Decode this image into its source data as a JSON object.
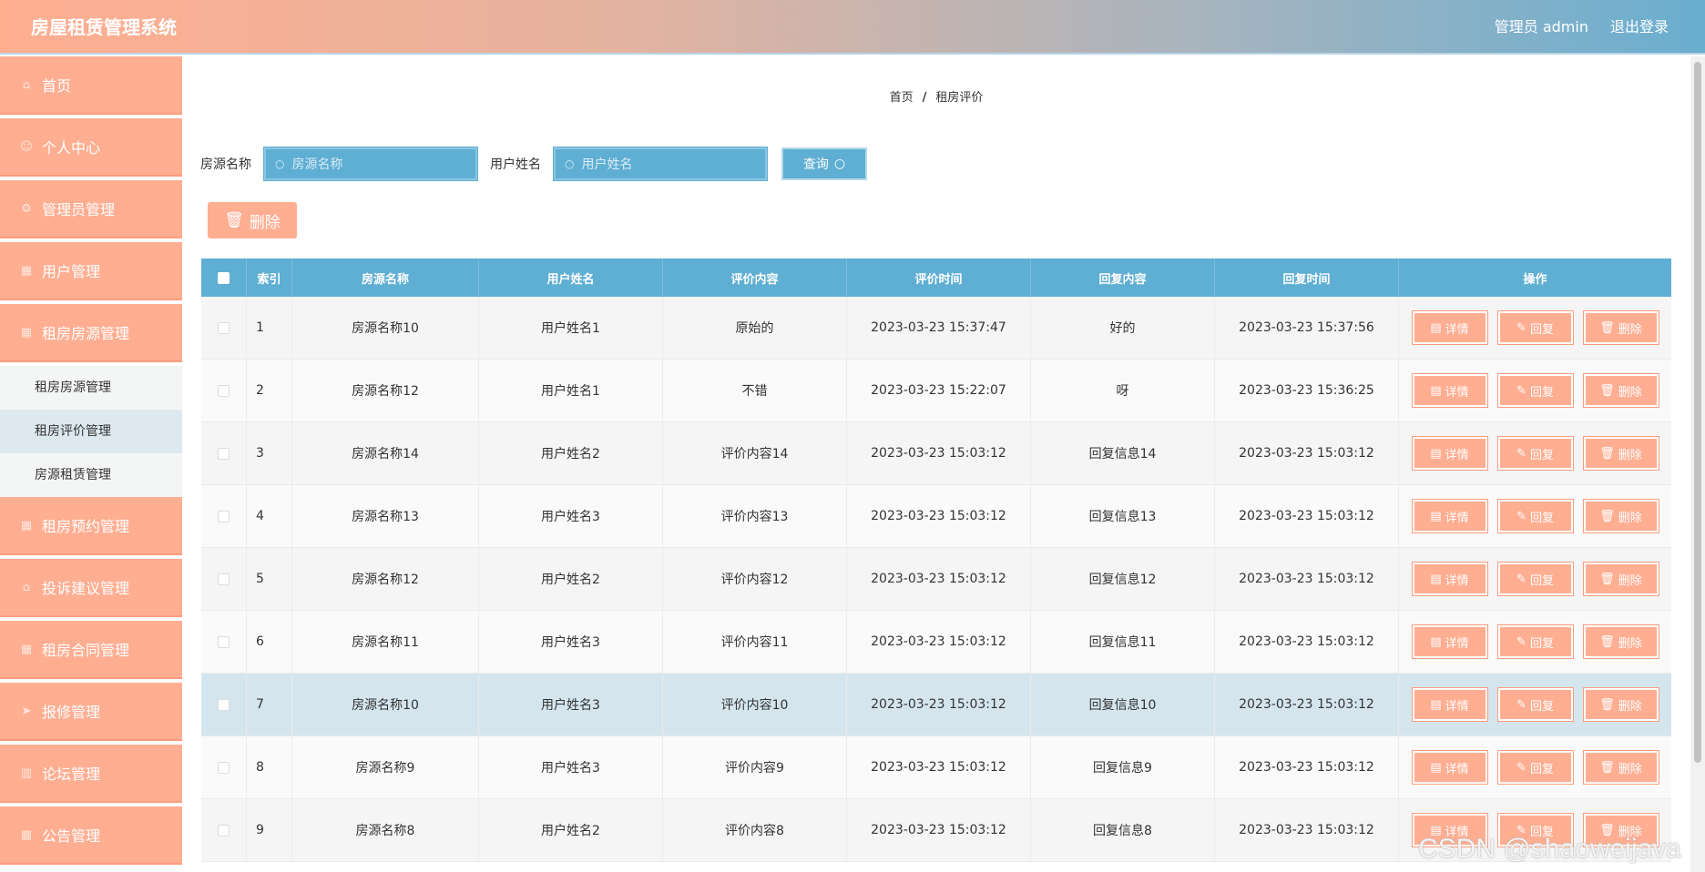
{
  "app": {
    "title": "房屋租赁管理系统"
  },
  "header": {
    "user": "管理员 admin",
    "logout": "退出登录"
  },
  "sidebar": {
    "items": [
      {
        "label": "首页",
        "icon": "home-icon",
        "glyph": "⌂"
      },
      {
        "label": "个人中心",
        "icon": "user-icon",
        "glyph": "☺"
      },
      {
        "label": "管理员管理",
        "icon": "settings-icon",
        "glyph": "⚙"
      },
      {
        "label": "用户管理",
        "icon": "grid-icon",
        "glyph": "▦"
      },
      {
        "label": "租房房源管理",
        "icon": "grid-icon",
        "glyph": "▦"
      }
    ],
    "submenu": [
      {
        "label": "租房房源管理"
      },
      {
        "label": "租房评价管理"
      },
      {
        "label": "房源租赁管理"
      }
    ],
    "items_after": [
      {
        "label": "租房预约管理",
        "icon": "grid-icon",
        "glyph": "▦"
      },
      {
        "label": "投诉建议管理",
        "icon": "home-icon",
        "glyph": "⌂"
      },
      {
        "label": "租房合同管理",
        "icon": "grid-icon",
        "glyph": "▦"
      },
      {
        "label": "报修管理",
        "icon": "send-icon",
        "glyph": "➤"
      },
      {
        "label": "论坛管理",
        "icon": "chart-icon",
        "glyph": "▥"
      },
      {
        "label": "公告管理",
        "icon": "grid-icon",
        "glyph": "▦"
      }
    ]
  },
  "breadcrumb": {
    "home": "首页",
    "separator": "/",
    "current": "租房评价"
  },
  "search": {
    "house_label": "房源名称",
    "house_placeholder": "房源名称",
    "user_label": "用户姓名",
    "user_placeholder": "用户姓名",
    "query_label": "查询"
  },
  "actions": {
    "delete_label": "删除"
  },
  "table": {
    "headers": [
      "索引",
      "房源名称",
      "用户姓名",
      "评价内容",
      "评价时间",
      "回复内容",
      "回复时间",
      "操作"
    ],
    "row_actions": {
      "detail": "详情",
      "reply": "回复",
      "delete": "删除"
    },
    "rows": [
      {
        "index": "1",
        "house": "房源名称10",
        "user": "用户姓名1",
        "content": "原始的",
        "time": "2023-03-23 15:37:47",
        "reply": "好的",
        "reply_time": "2023-03-23 15:37:56"
      },
      {
        "index": "2",
        "house": "房源名称12",
        "user": "用户姓名1",
        "content": "不错",
        "time": "2023-03-23 15:22:07",
        "reply": "呀",
        "reply_time": "2023-03-23 15:36:25"
      },
      {
        "index": "3",
        "house": "房源名称14",
        "user": "用户姓名2",
        "content": "评价内容14",
        "time": "2023-03-23 15:03:12",
        "reply": "回复信息14",
        "reply_time": "2023-03-23 15:03:12"
      },
      {
        "index": "4",
        "house": "房源名称13",
        "user": "用户姓名3",
        "content": "评价内容13",
        "time": "2023-03-23 15:03:12",
        "reply": "回复信息13",
        "reply_time": "2023-03-23 15:03:12"
      },
      {
        "index": "5",
        "house": "房源名称12",
        "user": "用户姓名2",
        "content": "评价内容12",
        "time": "2023-03-23 15:03:12",
        "reply": "回复信息12",
        "reply_time": "2023-03-23 15:03:12"
      },
      {
        "index": "6",
        "house": "房源名称11",
        "user": "用户姓名3",
        "content": "评价内容11",
        "time": "2023-03-23 15:03:12",
        "reply": "回复信息11",
        "reply_time": "2023-03-23 15:03:12"
      },
      {
        "index": "7",
        "house": "房源名称10",
        "user": "用户姓名3",
        "content": "评价内容10",
        "time": "2023-03-23 15:03:12",
        "reply": "回复信息10",
        "reply_time": "2023-03-23 15:03:12"
      },
      {
        "index": "8",
        "house": "房源名称9",
        "user": "用户姓名3",
        "content": "评价内容9",
        "time": "2023-03-23 15:03:12",
        "reply": "回复信息9",
        "reply_time": "2023-03-23 15:03:12"
      },
      {
        "index": "9",
        "house": "房源名称8",
        "user": "用户姓名2",
        "content": "评价内容8",
        "time": "2023-03-23 15:03:12",
        "reply": "回复信息8",
        "reply_time": "2023-03-23 15:03:12"
      }
    ]
  },
  "watermark": "CSDN @shaoweijava",
  "colors": {
    "accent": "#ffae92",
    "primary": "#5faed3",
    "highlight": "#d4e5ee"
  }
}
